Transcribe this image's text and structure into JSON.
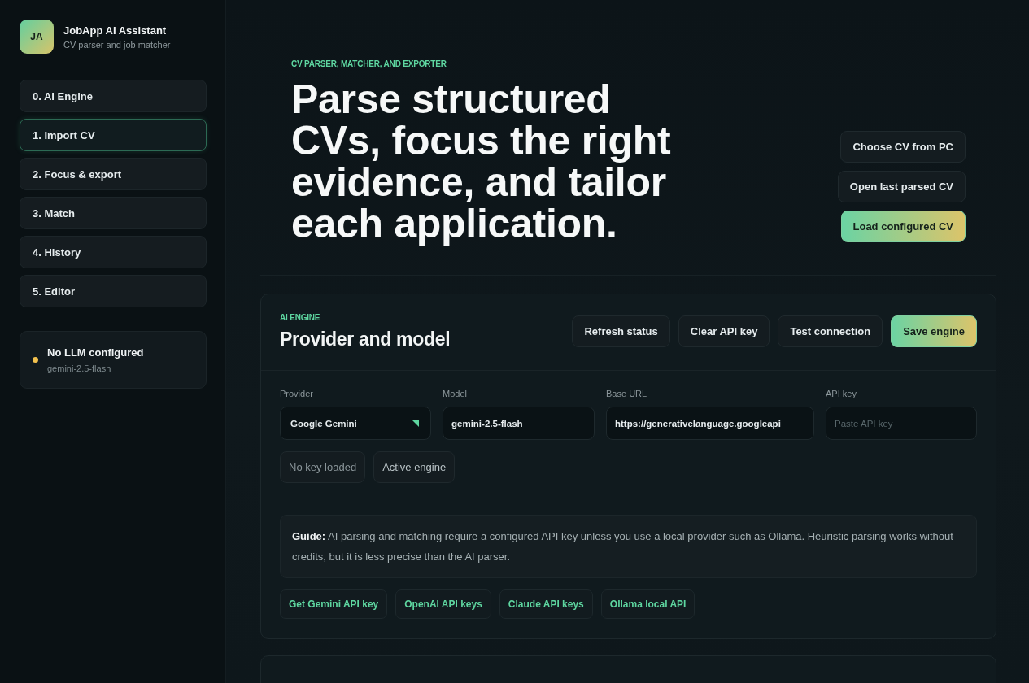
{
  "sidebar": {
    "brand": {
      "initials": "JA",
      "title": "JobApp AI Assistant",
      "subtitle": "CV parser and job matcher"
    },
    "nav": [
      {
        "label": "0. AI Engine",
        "selected": false
      },
      {
        "label": "1. Import CV",
        "selected": true
      },
      {
        "label": "2. Focus & export",
        "selected": false
      },
      {
        "label": "3. Match",
        "selected": false
      },
      {
        "label": "4. History",
        "selected": false
      },
      {
        "label": "5. Editor",
        "selected": false
      }
    ],
    "status": {
      "title": "No LLM configured",
      "detail": "gemini-2.5-flash",
      "configured": false
    }
  },
  "hero": {
    "eyebrow": "CV PARSER, MATCHER, AND EXPORTER",
    "title": "Parse structured CVs, focus the right evidence, and tailor each application.",
    "actions": [
      {
        "label": "Choose CV from PC",
        "kind": "secondary"
      },
      {
        "label": "Open last parsed CV",
        "kind": "secondary"
      },
      {
        "label": "Load configured CV",
        "kind": "primary"
      }
    ]
  },
  "engine_card": {
    "eyebrow": "AI ENGINE",
    "title": "Provider and model",
    "actions": [
      {
        "label": "Refresh status",
        "kind": "secondary"
      },
      {
        "label": "Clear API key",
        "kind": "secondary"
      },
      {
        "label": "Test connection",
        "kind": "secondary"
      },
      {
        "label": "Save engine",
        "kind": "primary"
      }
    ],
    "fields": [
      {
        "label": "Provider",
        "kind": "select",
        "value": "Google Gemini"
      },
      {
        "label": "Model",
        "kind": "text",
        "value": "gemini-2.5-flash"
      },
      {
        "label": "Base URL",
        "kind": "text",
        "value": "https://generativelanguage.googleapi"
      },
      {
        "label": "API key",
        "kind": "text",
        "placeholder": "Paste API key"
      }
    ],
    "badges": [
      {
        "label": "No key loaded",
        "kind": "muted"
      },
      {
        "label": "Active engine",
        "kind": "neutral"
      }
    ],
    "guide": "**Guide:** AI parsing and matching require a configured API key unless you use a local provider such as Ollama. Heuristic parsing works without credits, but it is less precise than the AI parser.",
    "links": [
      "Get Gemini API key",
      "OpenAI API keys",
      "Claude API keys",
      "Ollama local API"
    ]
  }
}
